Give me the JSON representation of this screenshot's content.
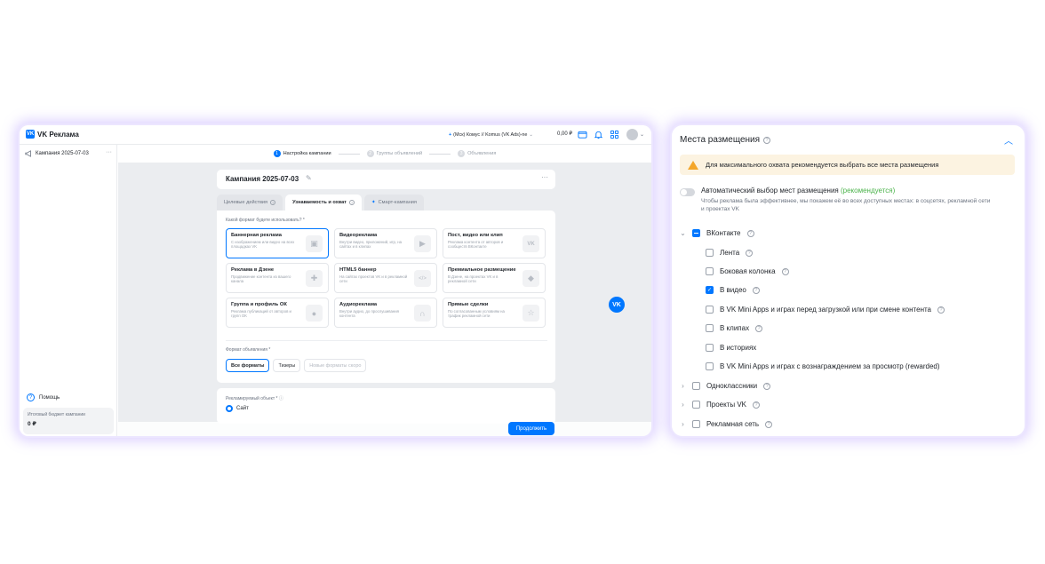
{
  "app": {
    "logo_text": "VK Реклама",
    "account": "(Мск) Комус // Komus (VK Ads)-ne",
    "balance": "0,00 ₽"
  },
  "sidebar": {
    "campaign": "Кампания 2025-07-03",
    "help": "Помощь",
    "budget_label": "Итоговый бюджет кампании",
    "budget_value": "0 ₽"
  },
  "stepper": {
    "steps": [
      {
        "num": "1",
        "label": "Настройка кампании"
      },
      {
        "num": "2",
        "label": "Группы объявлений"
      },
      {
        "num": "3",
        "label": "Объявления"
      }
    ]
  },
  "campaign": {
    "title": "Кампания 2025-07-03",
    "tabs": [
      "Целевые действия",
      "Узнаваемость и охват",
      "Смарт-кампания"
    ],
    "format_question": "Какой формат будете использовать? *",
    "formats": [
      {
        "name": "Баннерная реклама",
        "desc": "С изображением или видео на всех площадках VK",
        "icon": "image-icon"
      },
      {
        "name": "Видеореклама",
        "desc": "Внутри видео, приложений, игр, на сайтах и в клипах",
        "icon": "play-icon"
      },
      {
        "name": "Пост, видео или клип",
        "desc": "Реклама контента от авторов и сообществ ВКонтакте",
        "icon": "vk-icon"
      },
      {
        "name": "Реклама в Дзене",
        "desc": "Продвижение контента из вашего канала",
        "icon": "plus-icon"
      },
      {
        "name": "HTML5 баннер",
        "desc": "На сайтах проектов VK и в рекламной сети",
        "icon": "code-icon"
      },
      {
        "name": "Премиальное размещение",
        "desc": "В Дзене, на проектах VK и в рекламной сети",
        "icon": "diamond-icon"
      },
      {
        "name": "Группа и профиль ОК",
        "desc": "Реклама публикаций от авторов и групп ОК",
        "icon": "ok-icon"
      },
      {
        "name": "Аудиореклама",
        "desc": "Внутри аудио, до прослушивания контента",
        "icon": "headphones-icon"
      },
      {
        "name": "Прямые сделки",
        "desc": "По согласованным условиям на трафик рекламной сети",
        "icon": "star-icon"
      }
    ],
    "ad_format_label": "Формат объявления *",
    "ad_formats": [
      "Все форматы",
      "Тизеры",
      "Новые форматы скоро"
    ],
    "object_label": "Рекламируемый объект *",
    "object_option": "Сайт",
    "continue": "Продолжить",
    "fab_label": "VK"
  },
  "placements": {
    "title": "Места размещения",
    "warning": "Для максимального охвата рекомендуется выбрать все места размещения",
    "auto_title": "Автоматический выбор мест размещения",
    "auto_rec": "(рекомендуется)",
    "auto_sub": "Чтобы реклама была эффективнее, мы покажем её во всех доступных местах: в соцсетях, рекламной сети и проектах VK",
    "vk": {
      "label": "ВКонтакте",
      "items": [
        {
          "label": "Лента",
          "checked": false,
          "help": true
        },
        {
          "label": "Боковая колонка",
          "checked": false,
          "help": true
        },
        {
          "label": "В видео",
          "checked": true,
          "help": true
        },
        {
          "label": "В VK Mini Apps и играх перед загрузкой или при смене контента",
          "checked": false,
          "help": true
        },
        {
          "label": "В клипах",
          "checked": false,
          "help": true
        },
        {
          "label": "В историях",
          "checked": false,
          "help": false
        },
        {
          "label": "В VK Mini Apps и играх с вознаграждением за просмотр (rewarded)",
          "checked": false,
          "help": false
        }
      ]
    },
    "groups": [
      {
        "label": "Одноклассники"
      },
      {
        "label": "Проекты VK"
      },
      {
        "label": "Рекламная сеть"
      }
    ]
  }
}
